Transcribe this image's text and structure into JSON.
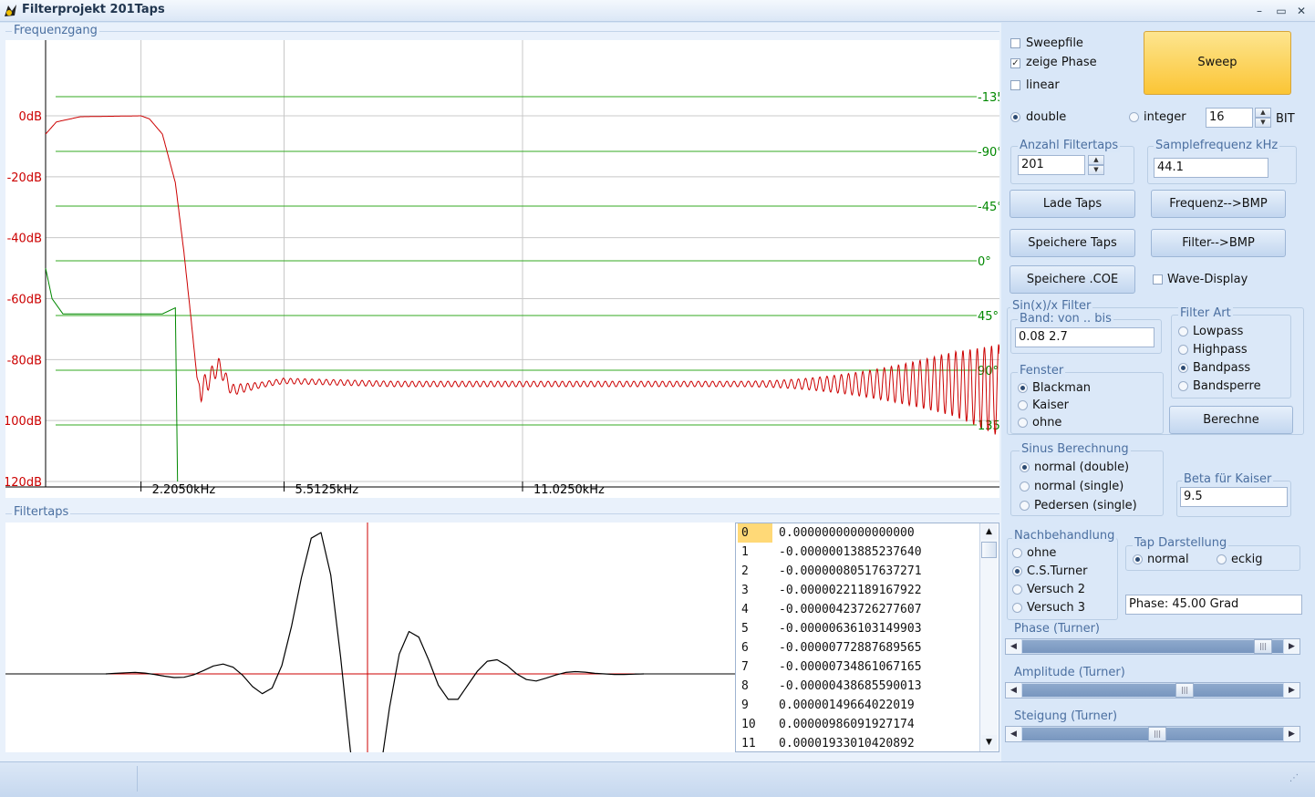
{
  "window": {
    "title": "Filterprojekt 201Taps",
    "min": "–",
    "max": "▭",
    "close": "✕"
  },
  "freq_panel": {
    "label": "Frequenzgang"
  },
  "taps_panel": {
    "label": "Filtertaps"
  },
  "chart_data": [
    {
      "type": "line",
      "name": "frequency-response",
      "y_ticks_left": [
        "0dB",
        "-20dB",
        "-40dB",
        "-60dB",
        "-80dB",
        "-100dB",
        "-120dB"
      ],
      "y_values_left": [
        0,
        -20,
        -40,
        -60,
        -80,
        -100,
        -120
      ],
      "y_ticks_right": [
        "-135°",
        "-90°",
        "-45°",
        "0°",
        "45°",
        "90°",
        "135°"
      ],
      "y_values_right": [
        -135,
        -90,
        -45,
        0,
        45,
        90,
        135
      ],
      "x_tick_labels": [
        "2.2050kHz",
        "5.5125kHz",
        "11.0250kHz"
      ],
      "x_tick_values": [
        2.205,
        5.5125,
        11.025
      ],
      "xlim": [
        0,
        22.05
      ],
      "ylim": [
        -120,
        0
      ],
      "series": [
        {
          "color": "#cc0000",
          "points": [
            [
              0,
              -6
            ],
            [
              0.25,
              -2
            ],
            [
              0.8,
              -0.3
            ],
            [
              2.205,
              0
            ],
            [
              2.4,
              -1
            ],
            [
              2.7,
              -6
            ],
            [
              3.0,
              -22
            ],
            [
              3.2,
              -45
            ],
            [
              3.35,
              -65
            ],
            [
              3.5,
              -86
            ],
            [
              3.6,
              -90
            ],
            [
              4.0,
              -82
            ],
            [
              4.3,
              -90
            ],
            [
              5.5,
              -87
            ],
            [
              8,
              -88
            ],
            [
              11,
              -88
            ],
            [
              15,
              -88
            ],
            [
              19,
              -88
            ],
            [
              21,
              -88
            ],
            [
              22,
              -90
            ]
          ]
        },
        {
          "color": "#008800",
          "points": [
            [
              0,
              -50
            ],
            [
              0.15,
              -60
            ],
            [
              0.4,
              -65
            ],
            [
              1.5,
              -65
            ],
            [
              2.7,
              -65
            ],
            [
              3.0,
              -63
            ],
            [
              3.05,
              -120
            ]
          ]
        }
      ]
    },
    {
      "type": "line",
      "name": "impulse-response",
      "series": [
        {
          "color": "#000000",
          "values": [
            0,
            0.002,
            0.004,
            0.005,
            0.003,
            -0.002,
            -0.008,
            -0.013,
            -0.012,
            -0.003,
            0.012,
            0.028,
            0.035,
            0.024,
            -0.005,
            -0.045,
            -0.07,
            -0.05,
            0.03,
            0.17,
            0.34,
            0.48,
            0.5,
            0.35,
            0.06,
            -0.27,
            -0.5,
            -0.52,
            -0.36,
            -0.12,
            0.07,
            0.15,
            0.13,
            0.05,
            -0.04,
            -0.09,
            -0.09,
            -0.04,
            0.01,
            0.045,
            0.05,
            0.03,
            0,
            -0.02,
            -0.025,
            -0.015,
            -0.004,
            0.005,
            0.008,
            0.006,
            0.002,
            0,
            -0.002,
            -0.002,
            -0.001,
            0
          ]
        }
      ]
    }
  ],
  "taps": [
    {
      "i": "0",
      "v": "0.00000000000000000"
    },
    {
      "i": "1",
      "v": "-0.00000013885237640"
    },
    {
      "i": "2",
      "v": "-0.00000080517637271"
    },
    {
      "i": "3",
      "v": "-0.00000221189167922"
    },
    {
      "i": "4",
      "v": "-0.00000423726277607"
    },
    {
      "i": "5",
      "v": "-0.00000636103149903"
    },
    {
      "i": "6",
      "v": "-0.00000772887689565"
    },
    {
      "i": "7",
      "v": "-0.00000734861067165"
    },
    {
      "i": "8",
      "v": "-0.00000438685590013"
    },
    {
      "i": "9",
      "v": "0.00000149664022019"
    },
    {
      "i": "10",
      "v": "0.00000986091927174"
    },
    {
      "i": "11",
      "v": "0.00001933010420892"
    }
  ],
  "controls": {
    "sweepfile": "Sweepfile",
    "zeige_phase": "zeige Phase",
    "linear": "linear",
    "sweep": "Sweep",
    "double": "double",
    "integer": "integer",
    "bits_value": "16",
    "bit_label": "BIT",
    "anzahl_label": "Anzahl Filtertaps",
    "anzahl_value": "201",
    "sample_label": "Samplefrequenz kHz",
    "sample_value": "44.1",
    "lade_taps": "Lade Taps",
    "freq_bmp": "Frequenz-->BMP",
    "speichere_taps": "Speichere Taps",
    "filter_bmp": "Filter-->BMP",
    "speichere_coe": "Speichere .COE",
    "wave_display": "Wave-Display",
    "sinx_label": "Sin(x)/x Filter",
    "band_label": "Band: von .. bis",
    "band_value": "0.08  2.7",
    "filterart_label": "Filter Art",
    "lowpass": "Lowpass",
    "highpass": "Highpass",
    "bandpass": "Bandpass",
    "bandsperre": "Bandsperre",
    "fenster_label": "Fenster",
    "blackman": "Blackman",
    "kaiser": "Kaiser",
    "ohne": "ohne",
    "berechne": "Berechne",
    "sinus_label": "Sinus Berechnung",
    "normal_double": "normal (double)",
    "normal_single": "normal (single)",
    "pedersen": "Pedersen (single)",
    "beta_label": "Beta für Kaiser",
    "beta_value": "9.5",
    "nach_label": "Nachbehandlung",
    "nach_ohne": "ohne",
    "cs_turner": "C.S.Turner",
    "versuch2": "Versuch 2",
    "versuch3": "Versuch 3",
    "tapdar_label": "Tap Darstellung",
    "tap_normal": "normal",
    "tap_eckig": "eckig",
    "phase_value": "Phase:  45.00 Grad",
    "phase_turner": "Phase (Turner)",
    "amplitude_turner": "Amplitude (Turner)",
    "steigung_turner": "Steigung (Turner)"
  },
  "colors": {
    "response": "#cc0000",
    "phase": "#008800",
    "grid": "#c8c8c8",
    "accent_sweep": "#fbc535"
  }
}
